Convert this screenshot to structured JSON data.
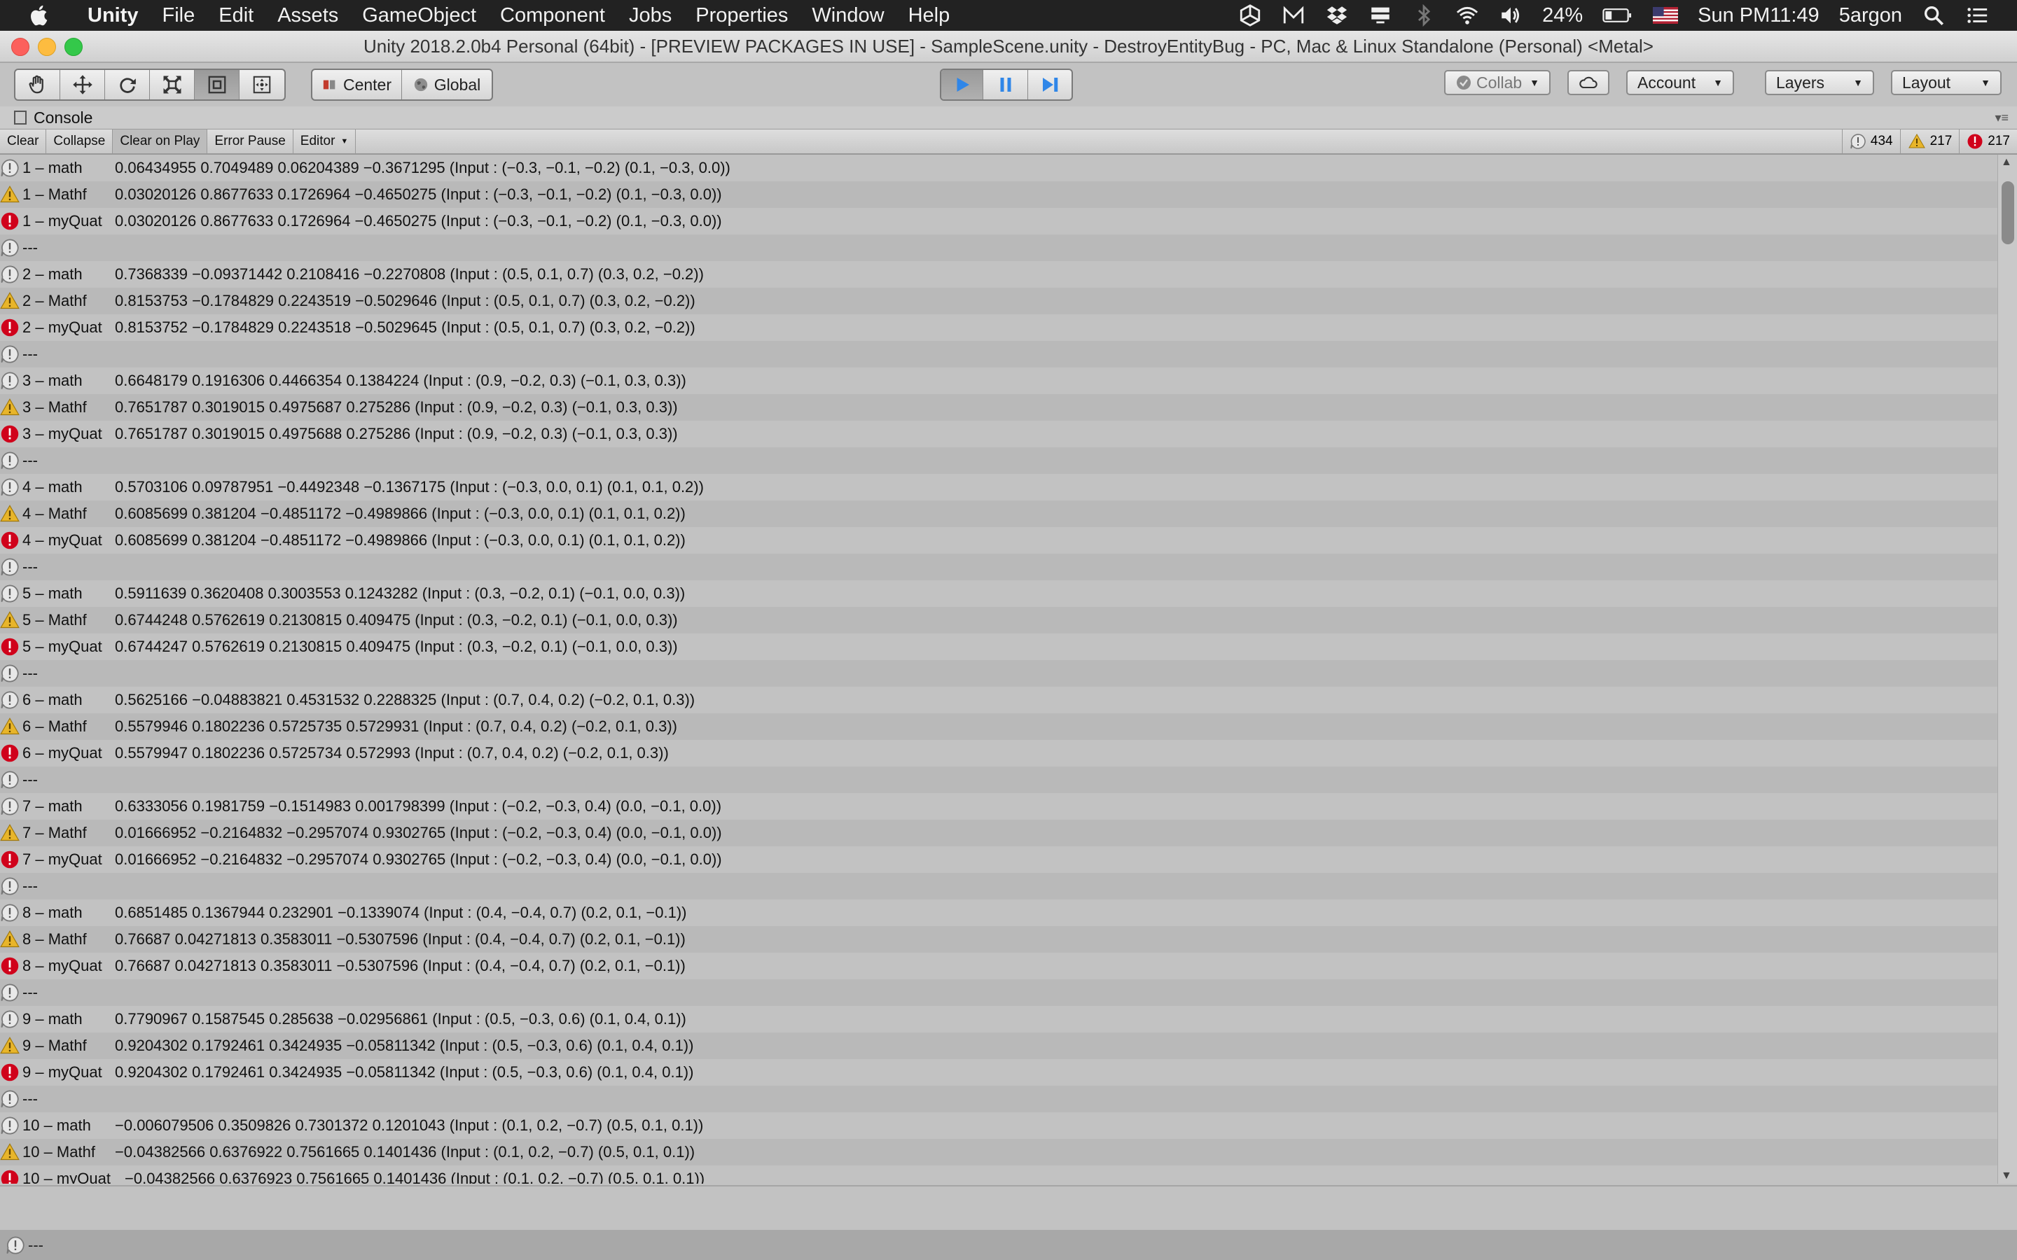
{
  "menubar": {
    "app": "Unity",
    "items": [
      "File",
      "Edit",
      "Assets",
      "GameObject",
      "Component",
      "Jobs",
      "Properties",
      "Window",
      "Help"
    ],
    "battery": "24%",
    "clock": "Sun PM11:49",
    "user": "5argon"
  },
  "window": {
    "title": "Unity 2018.2.0b4 Personal (64bit) - [PREVIEW PACKAGES IN USE] - SampleScene.unity - DestroyEntityBug - PC, Mac & Linux Standalone (Personal) <Metal>"
  },
  "toolbar": {
    "pivot": "Center",
    "space": "Global",
    "collab": "Collab",
    "account": "Account",
    "layers": "Layers",
    "layout": "Layout"
  },
  "console": {
    "tab_title": "Console",
    "buttons": {
      "clear": "Clear",
      "collapse": "Collapse",
      "clear_on_play": "Clear on Play",
      "error_pause": "Error Pause",
      "editor": "Editor"
    },
    "counts": {
      "log": "434",
      "warning": "217",
      "error": "217"
    },
    "entries": [
      {
        "type": "log",
        "prefix": "1 – math",
        "text": "0.06434955 0.7049489 0.06204389 −0.3671295 (Input : (−0.3, −0.1, −0.2) (0.1, −0.3, 0.0))"
      },
      {
        "type": "warning",
        "prefix": "1 – Mathf",
        "text": "0.03020126 0.8677633 0.1726964 −0.4650275 (Input : (−0.3, −0.1, −0.2) (0.1, −0.3, 0.0))"
      },
      {
        "type": "error",
        "prefix": "1 – myQuat",
        "text": "0.03020126 0.8677633 0.1726964 −0.4650275 (Input : (−0.3, −0.1, −0.2) (0.1, −0.3, 0.0))"
      },
      {
        "type": "log",
        "prefix": "---",
        "text": ""
      },
      {
        "type": "log",
        "prefix": "2 – math",
        "text": "0.7368339 −0.09371442 0.2108416 −0.2270808 (Input : (0.5, 0.1, 0.7) (0.3, 0.2, −0.2))"
      },
      {
        "type": "warning",
        "prefix": "2 – Mathf",
        "text": "0.8153753 −0.1784829 0.2243519 −0.5029646 (Input : (0.5, 0.1, 0.7) (0.3, 0.2, −0.2))"
      },
      {
        "type": "error",
        "prefix": "2 – myQuat",
        "text": "0.8153752 −0.1784829 0.2243518 −0.5029645 (Input : (0.5, 0.1, 0.7) (0.3, 0.2, −0.2))"
      },
      {
        "type": "log",
        "prefix": "---",
        "text": ""
      },
      {
        "type": "log",
        "prefix": "3 – math",
        "text": "0.6648179 0.1916306 0.4466354 0.1384224 (Input : (0.9, −0.2, 0.3) (−0.1, 0.3, 0.3))"
      },
      {
        "type": "warning",
        "prefix": "3 – Mathf",
        "text": "0.7651787 0.3019015 0.4975687 0.275286 (Input : (0.9, −0.2, 0.3) (−0.1, 0.3, 0.3))"
      },
      {
        "type": "error",
        "prefix": "3 – myQuat",
        "text": "0.7651787 0.3019015 0.4975688 0.275286 (Input : (0.9, −0.2, 0.3) (−0.1, 0.3, 0.3))"
      },
      {
        "type": "log",
        "prefix": "---",
        "text": ""
      },
      {
        "type": "log",
        "prefix": "4 – math",
        "text": "0.5703106 0.09787951 −0.4492348 −0.1367175 (Input : (−0.3, 0.0, 0.1) (0.1, 0.1, 0.2))"
      },
      {
        "type": "warning",
        "prefix": "4 – Mathf",
        "text": "0.6085699 0.381204 −0.4851172 −0.4989866 (Input : (−0.3, 0.0, 0.1) (0.1, 0.1, 0.2))"
      },
      {
        "type": "error",
        "prefix": "4 – myQuat",
        "text": "0.6085699 0.381204 −0.4851172 −0.4989866 (Input : (−0.3, 0.0, 0.1) (0.1, 0.1, 0.2))"
      },
      {
        "type": "log",
        "prefix": "---",
        "text": ""
      },
      {
        "type": "log",
        "prefix": "5 – math",
        "text": "0.5911639 0.3620408 0.3003553 0.1243282 (Input : (0.3, −0.2, 0.1) (−0.1, 0.0, 0.3))"
      },
      {
        "type": "warning",
        "prefix": "5 – Mathf",
        "text": "0.6744248 0.5762619 0.2130815 0.409475 (Input : (0.3, −0.2, 0.1) (−0.1, 0.0, 0.3))"
      },
      {
        "type": "error",
        "prefix": "5 – myQuat",
        "text": "0.6744247 0.5762619 0.2130815 0.409475 (Input : (0.3, −0.2, 0.1) (−0.1, 0.0, 0.3))"
      },
      {
        "type": "log",
        "prefix": "---",
        "text": ""
      },
      {
        "type": "log",
        "prefix": "6 – math",
        "text": "0.5625166 −0.04883821 0.4531532 0.2288325 (Input : (0.7, 0.4, 0.2) (−0.2, 0.1, 0.3))"
      },
      {
        "type": "warning",
        "prefix": "6 – Mathf",
        "text": "0.5579946 0.1802236 0.5725735 0.5729931 (Input : (0.7, 0.4, 0.2) (−0.2, 0.1, 0.3))"
      },
      {
        "type": "error",
        "prefix": "6 – myQuat",
        "text": "0.5579947 0.1802236 0.5725734 0.572993 (Input : (0.7, 0.4, 0.2) (−0.2, 0.1, 0.3))"
      },
      {
        "type": "log",
        "prefix": "---",
        "text": ""
      },
      {
        "type": "log",
        "prefix": "7 – math",
        "text": "0.6333056 0.1981759 −0.1514983 0.001798399 (Input : (−0.2, −0.3, 0.4) (0.0, −0.1, 0.0))"
      },
      {
        "type": "warning",
        "prefix": "7 – Mathf",
        "text": "0.01666952 −0.2164832 −0.2957074 0.9302765 (Input : (−0.2, −0.3, 0.4) (0.0, −0.1, 0.0))"
      },
      {
        "type": "error",
        "prefix": "7 – myQuat",
        "text": "0.01666952 −0.2164832 −0.2957074 0.9302765 (Input : (−0.2, −0.3, 0.4) (0.0, −0.1, 0.0))"
      },
      {
        "type": "log",
        "prefix": "---",
        "text": ""
      },
      {
        "type": "log",
        "prefix": "8 – math",
        "text": "0.6851485 0.1367944 0.232901 −0.1339074 (Input : (0.4, −0.4, 0.7) (0.2, 0.1, −0.1))"
      },
      {
        "type": "warning",
        "prefix": "8 – Mathf",
        "text": "0.76687 0.04271813 0.3583011 −0.5307596 (Input : (0.4, −0.4, 0.7) (0.2, 0.1, −0.1))"
      },
      {
        "type": "error",
        "prefix": "8 – myQuat",
        "text": "0.76687 0.04271813 0.3583011 −0.5307596 (Input : (0.4, −0.4, 0.7) (0.2, 0.1, −0.1))"
      },
      {
        "type": "log",
        "prefix": "---",
        "text": ""
      },
      {
        "type": "log",
        "prefix": "9 – math",
        "text": "0.7790967 0.1587545 0.285638 −0.02956861 (Input : (0.5, −0.3, 0.6) (0.1, 0.4, 0.1))"
      },
      {
        "type": "warning",
        "prefix": "9 – Mathf",
        "text": "0.9204302 0.1792461 0.3424935 −0.05811342 (Input : (0.5, −0.3, 0.6) (0.1, 0.4, 0.1))"
      },
      {
        "type": "error",
        "prefix": "9 – myQuat",
        "text": "0.9204302 0.1792461 0.3424935 −0.05811342 (Input : (0.5, −0.3, 0.6) (0.1, 0.4, 0.1))"
      },
      {
        "type": "log",
        "prefix": "---",
        "text": ""
      },
      {
        "type": "log",
        "prefix": "10 – math",
        "text": "−0.006079506 0.3509826 0.7301372 0.1201043 (Input : (0.1, 0.2, −0.7) (0.5, 0.1, 0.1))"
      },
      {
        "type": "warning",
        "prefix": "10 – Mathf",
        "text": "−0.04382566 0.6376922 0.7561665 0.1401436 (Input : (0.1, 0.2, −0.7) (0.5, 0.1, 0.1))"
      },
      {
        "type": "error",
        "prefix": "10 – myQuat",
        "text": "−0.04382566 0.6376923 0.7561665 0.1401436 (Input : (0.1, 0.2, −0.7) (0.5, 0.1, 0.1))"
      }
    ]
  },
  "statusbar": {
    "text": "---"
  },
  "colors": {
    "error": "#d0021b",
    "warning": "#e8b52a",
    "log": "#e8e8e8",
    "play_active": "#2f86e8"
  },
  "icons": {
    "log": "info-icon",
    "warning": "warning-icon",
    "error": "error-icon",
    "toolbar": [
      "hand-tool-icon",
      "move-tool-icon",
      "rotate-tool-icon",
      "scale-tool-icon",
      "rect-tool-icon",
      "transform-tool-icon"
    ]
  }
}
